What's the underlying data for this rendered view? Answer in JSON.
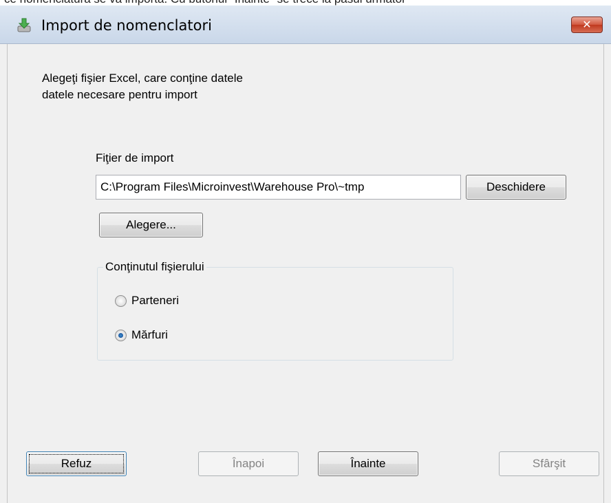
{
  "doc_snippet": "ce nomenclatură se va importa. Cu butonul \"Înainte\" se trece la pasul următor",
  "window": {
    "title": "Import de nomenclatori",
    "close_label": "✕"
  },
  "instructions": "Alegeţi fişier Excel, care conţine datele\ndatele necesare pentru import",
  "file": {
    "label": "Fiţier de import",
    "path_value": "C:\\Program Files\\Microinvest\\Warehouse Pro\\~tmp",
    "open_button": "Deschidere",
    "choose_button": "Alegere..."
  },
  "content_group": {
    "title": "Conţinutul fişierului",
    "options": [
      {
        "label": "Parteneri",
        "checked": false
      },
      {
        "label": "Mărfuri",
        "checked": true
      }
    ]
  },
  "footer": {
    "refuse": "Refuz",
    "back": "Înapoi",
    "next": "Înainte",
    "finish": "Sfârşit"
  },
  "colors": {
    "titlebar": "#c9d7e9",
    "close_button": "#c0391f",
    "window_bg": "#f0f0f0"
  }
}
